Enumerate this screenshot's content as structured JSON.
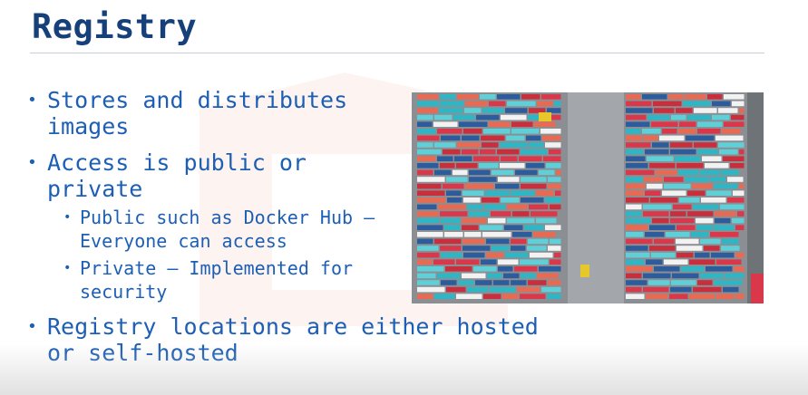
{
  "slide": {
    "title": "Registry",
    "bullets": [
      {
        "text": "Stores and distributes images"
      },
      {
        "text": "Access is public or private",
        "sub": [
          {
            "text": "Public such as Docker Hub – Everyone can access"
          },
          {
            "text": "Private – Implemented for security"
          }
        ]
      },
      {
        "text": "Registry locations are either hosted or self-hosted"
      }
    ],
    "bullet_glyph": "•",
    "image": {
      "subject": "aerial view of shipping container yard",
      "container_colors": [
        "#d9384a",
        "#2fb6c4",
        "#2d5c9c",
        "#e86a52",
        "#f2f2f2",
        "#c82e3c",
        "#5fd0d8"
      ]
    },
    "colors": {
      "title": "#15407a",
      "text": "#1d5fb4",
      "rule": "#c9cfd8"
    }
  }
}
